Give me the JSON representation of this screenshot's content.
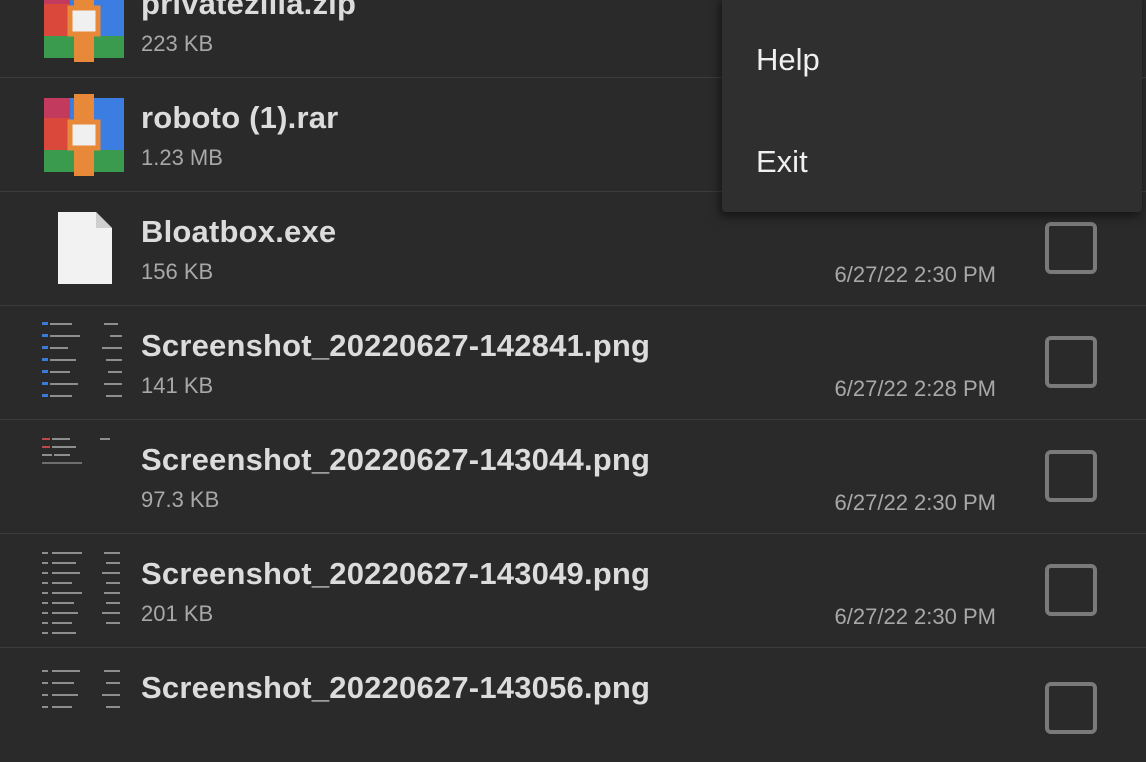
{
  "files": [
    {
      "name": "privatezilla.zip",
      "size": "223 KB",
      "date": "",
      "icon": "archive-icon"
    },
    {
      "name": "roboto (1).rar",
      "size": "1.23 MB",
      "date": "",
      "icon": "archive-icon"
    },
    {
      "name": "Bloatbox.exe",
      "size": "156 KB",
      "date": "6/27/22 2:30 PM",
      "icon": "file-icon"
    },
    {
      "name": "Screenshot_20220627-142841.png",
      "size": "141 KB",
      "date": "6/27/22 2:28 PM",
      "icon": "image-thumbnail"
    },
    {
      "name": "Screenshot_20220627-143044.png",
      "size": "97.3 KB",
      "date": "6/27/22 2:30 PM",
      "icon": "image-thumbnail"
    },
    {
      "name": "Screenshot_20220627-143049.png",
      "size": "201 KB",
      "date": "6/27/22 2:30 PM",
      "icon": "image-thumbnail"
    },
    {
      "name": "Screenshot_20220627-143056.png",
      "size": "",
      "date": "",
      "icon": "image-thumbnail"
    }
  ],
  "menu": {
    "items": [
      {
        "label": "Help"
      },
      {
        "label": "Exit"
      }
    ]
  },
  "colors": {
    "background": "#2a2a2a",
    "menu_background": "#2f2f2f",
    "checkbox_border": "#7a7a7a"
  }
}
